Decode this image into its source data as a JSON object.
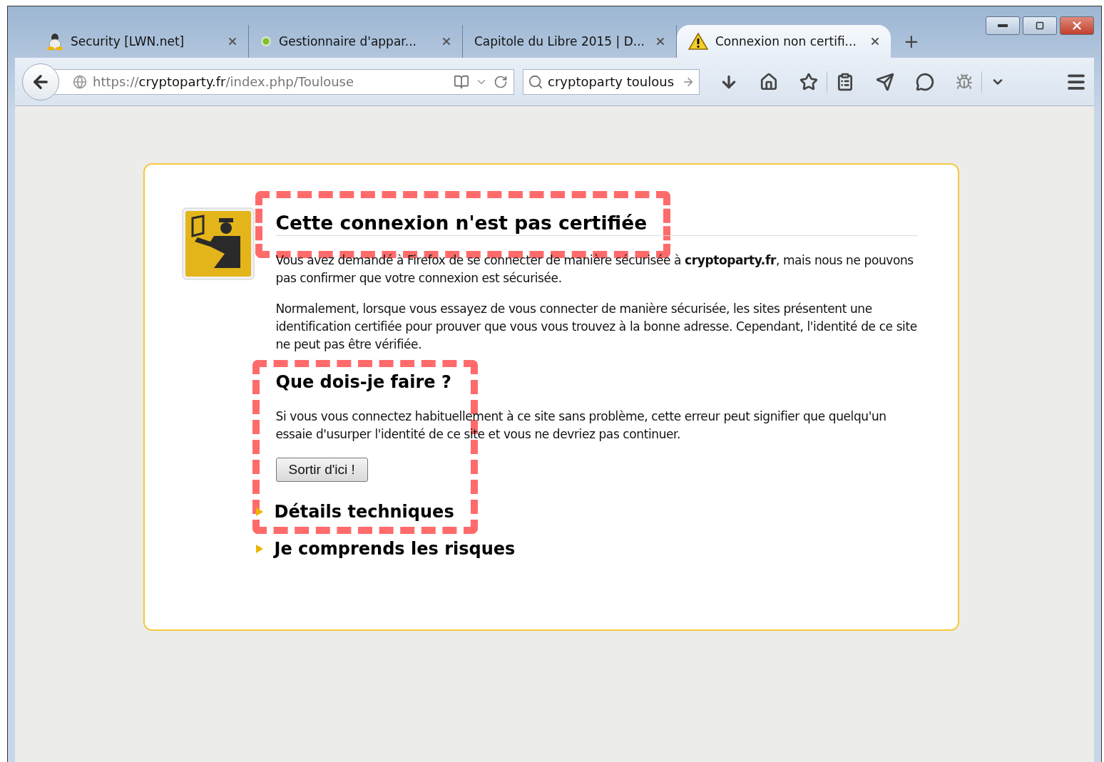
{
  "tabs": [
    {
      "label": "Security [LWN.net]",
      "selected": false,
      "kind": "penguin"
    },
    {
      "label": "Gestionnaire d'appar...",
      "selected": false,
      "kind": "dot"
    },
    {
      "label": "Capitole du Libre 2015 | D...",
      "selected": false,
      "kind": "plain"
    },
    {
      "label": "Connexion non certifi...",
      "selected": true,
      "kind": "warning"
    }
  ],
  "new_tab": "+",
  "toolbar": {
    "url": {
      "scheme": "https://",
      "host": "cryptoparty.fr",
      "path": "/index.php/Toulouse"
    },
    "search": {
      "value": "cryptoparty toulous"
    }
  },
  "page": {
    "title": "Cette connexion n'est pas certifiée",
    "title_highlighted": true,
    "paragraphs": [
      "Vous avez demandé à Firefox de se connecter de manière sécurisée à **cryptoparty.fr**, mais nous ne pouvons pas confirmer que votre connexion est sécurisée.",
      "Normalement, lorsque vous essayez de vous connecter de manière sécurisée, les sites présentent une identification certifiée pour prouver que vous vous trouvez à la bonne adresse. Cependant, l'identité de ce site ne peut pas être vérifiée."
    ],
    "section": {
      "heading": "Que dois-je faire ?",
      "highlighted": true,
      "text": "Si vous vous connectez habituellement à ce site sans problème, cette erreur peut signifier que quelqu'un essaie d'usurper l'identité de ce site et vous ne devriez pas continuer.",
      "button": "Sortir d'ici !"
    },
    "expanders": [
      {
        "label": "Détails techniques",
        "expanded": false
      },
      {
        "label": "Je comprends les risques",
        "expanded": false
      }
    ]
  }
}
